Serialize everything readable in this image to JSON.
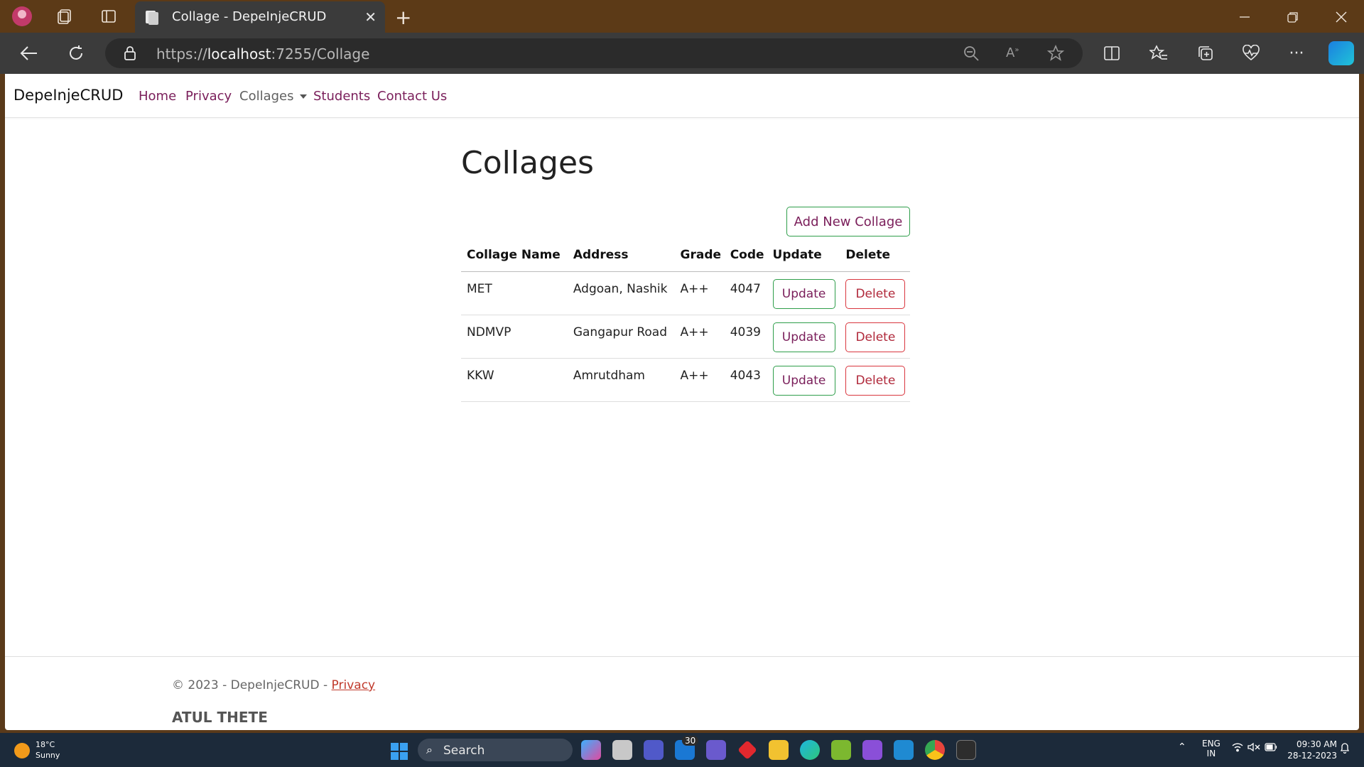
{
  "browser": {
    "tab_title": "Collage - DepeInjeCRUD",
    "url_scheme": "https://",
    "url_host": "localhost",
    "url_rest": ":7255/Collage"
  },
  "app": {
    "brand": "DepeInjeCRUD",
    "nav": {
      "home": "Home",
      "privacy": "Privacy",
      "collages": "Collages",
      "students": "Students",
      "contact": "Contact Us"
    },
    "heading": "Collages",
    "add_button": "Add New Collage",
    "table": {
      "headers": [
        "Collage Name",
        "Address",
        "Grade",
        "Code",
        "Update",
        "Delete"
      ],
      "rows": [
        {
          "name": "MET",
          "address": "Adgoan, Nashik",
          "grade": "A++",
          "code": "4047"
        },
        {
          "name": "NDMVP",
          "address": "Gangapur Road",
          "grade": "A++",
          "code": "4039"
        },
        {
          "name": "KKW",
          "address": "Amrutdham",
          "grade": "A++",
          "code": "4043"
        }
      ],
      "update_label": "Update",
      "delete_label": "Delete"
    },
    "footer": {
      "copyright": "© 2023 - DepeInjeCRUD - ",
      "privacy_link": "Privacy",
      "author": "ATUL THETE"
    }
  },
  "taskbar": {
    "temp": "18°C",
    "condition": "Sunny",
    "search_placeholder": "Search",
    "mail_badge": "30",
    "lang_top": "ENG",
    "lang_bottom": "IN",
    "time": "09:30 AM",
    "date": "28-12-2023"
  },
  "colors": {
    "nav_link": "#7a1e5a",
    "success_border": "#2e9e4a",
    "danger_border": "#d9363e"
  }
}
